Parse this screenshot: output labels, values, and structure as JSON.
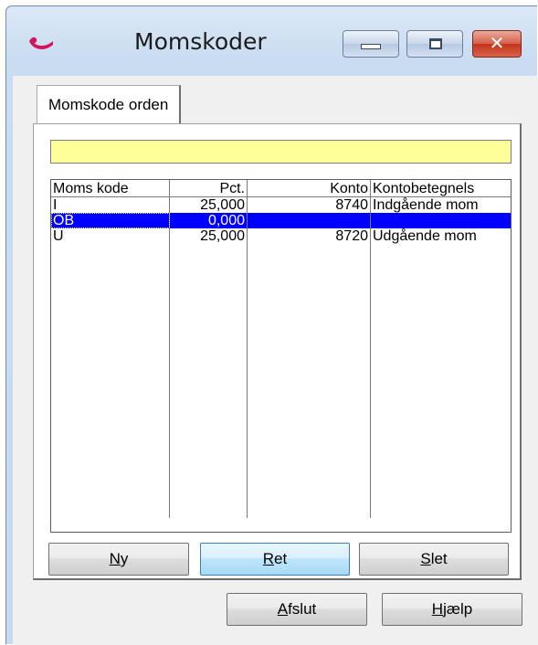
{
  "window": {
    "title": "Momskoder"
  },
  "caption": {
    "close_glyph": "✕"
  },
  "tabs": [
    {
      "label": "Momskode orden"
    }
  ],
  "filter_field": {
    "value": ""
  },
  "grid": {
    "columns": [
      "Moms kode",
      "Pct.",
      "Konto",
      "Kontobetegnels"
    ],
    "rows": [
      {
        "kode": "I",
        "pct": "25,000",
        "konto": "8740",
        "betegnelse": "Indgående mom"
      },
      {
        "kode": "OB",
        "pct": "0,000",
        "konto": "",
        "betegnelse": ""
      },
      {
        "kode": "U",
        "pct": "25,000",
        "konto": "8720",
        "betegnelse": "Udgående mom"
      }
    ],
    "selected_row": 1
  },
  "buttons": {
    "ny": {
      "mnemonic": "N",
      "rest": "y"
    },
    "ret": {
      "mnemonic": "R",
      "rest": "et"
    },
    "slet": {
      "mnemonic": "S",
      "rest": "let"
    },
    "afslut": {
      "mnemonic": "A",
      "rest": "fslut"
    },
    "hjaelp": {
      "mnemonic": "H",
      "rest": "jælp"
    }
  },
  "icons": {
    "app": "app-logo-icon",
    "minimize": "minimize-icon",
    "maximize": "maximize-icon",
    "close": "close-icon"
  },
  "colors": {
    "selection": "#0000ff",
    "filter_field": "#ffff99",
    "close_button": "#c4341c",
    "app_icon": "#d4145a"
  }
}
